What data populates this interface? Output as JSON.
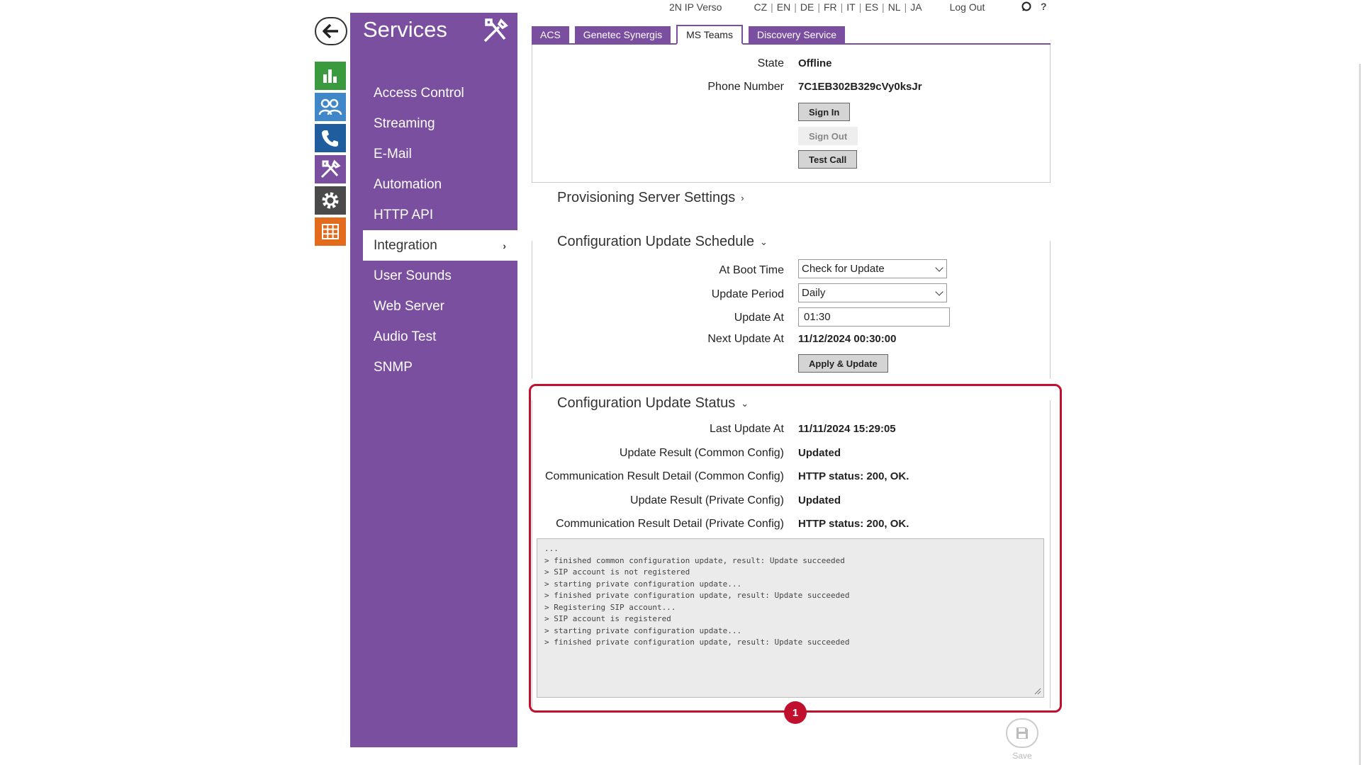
{
  "topbar": {
    "device": "2N IP Verso",
    "languages": [
      "CZ",
      "EN",
      "DE",
      "FR",
      "IT",
      "ES",
      "NL",
      "JA"
    ],
    "logout": "Log Out",
    "help": "?"
  },
  "sidebar": {
    "title": "Services",
    "items": [
      {
        "label": "Access Control"
      },
      {
        "label": "Streaming"
      },
      {
        "label": "E-Mail"
      },
      {
        "label": "Automation"
      },
      {
        "label": "HTTP API"
      },
      {
        "label": "Integration",
        "chevron": "›"
      },
      {
        "label": "User Sounds"
      },
      {
        "label": "Web Server"
      },
      {
        "label": "Audio Test"
      },
      {
        "label": "SNMP"
      }
    ]
  },
  "tabs": [
    {
      "label": "ACS"
    },
    {
      "label": "Genetec Synergis"
    },
    {
      "label": "MS Teams"
    },
    {
      "label": "Discovery Service"
    }
  ],
  "ms_teams": {
    "state_label": "State",
    "state_value": "Offline",
    "phone_label": "Phone Number",
    "phone_value": "7C1EB302B329cVy0ksJr",
    "sign_in": "Sign In",
    "sign_out": "Sign Out",
    "test_call": "Test Call"
  },
  "provisioning": {
    "title": "Provisioning Server Settings",
    "chevron": "›"
  },
  "schedule": {
    "title": "Configuration Update Schedule",
    "chevron": "⌄",
    "boot_label": "At Boot Time",
    "boot_value": "Check for Update",
    "period_label": "Update Period",
    "period_value": "Daily",
    "update_at_label": "Update At",
    "update_at_value": "01:30",
    "next_label": "Next Update At",
    "next_value": "11/12/2024 00:30:00",
    "apply_button": "Apply & Update"
  },
  "status": {
    "title": "Configuration Update Status",
    "chevron": "⌄",
    "rows": [
      {
        "label": "Last Update At",
        "value": "11/11/2024 15:29:05"
      },
      {
        "label": "Update Result (Common Config)",
        "value": "Updated"
      },
      {
        "label": "Communication Result Detail (Common Config)",
        "value": "HTTP status: 200, OK."
      },
      {
        "label": "Update Result (Private Config)",
        "value": "Updated"
      },
      {
        "label": "Communication Result Detail (Private Config)",
        "value": "HTTP status: 200, OK."
      }
    ],
    "log": "...\n> finished common configuration update, result: Update succeeded\n> SIP account is not registered\n> starting private configuration update...\n> finished private configuration update, result: Update succeeded\n> Registering SIP account...\n> SIP account is registered\n> starting private configuration update...\n> finished private configuration update, result: Update succeeded"
  },
  "marker": "1",
  "save": {
    "label": "Save"
  },
  "colors": {
    "accent": "#7b4fa0",
    "highlight": "#c0102e"
  }
}
